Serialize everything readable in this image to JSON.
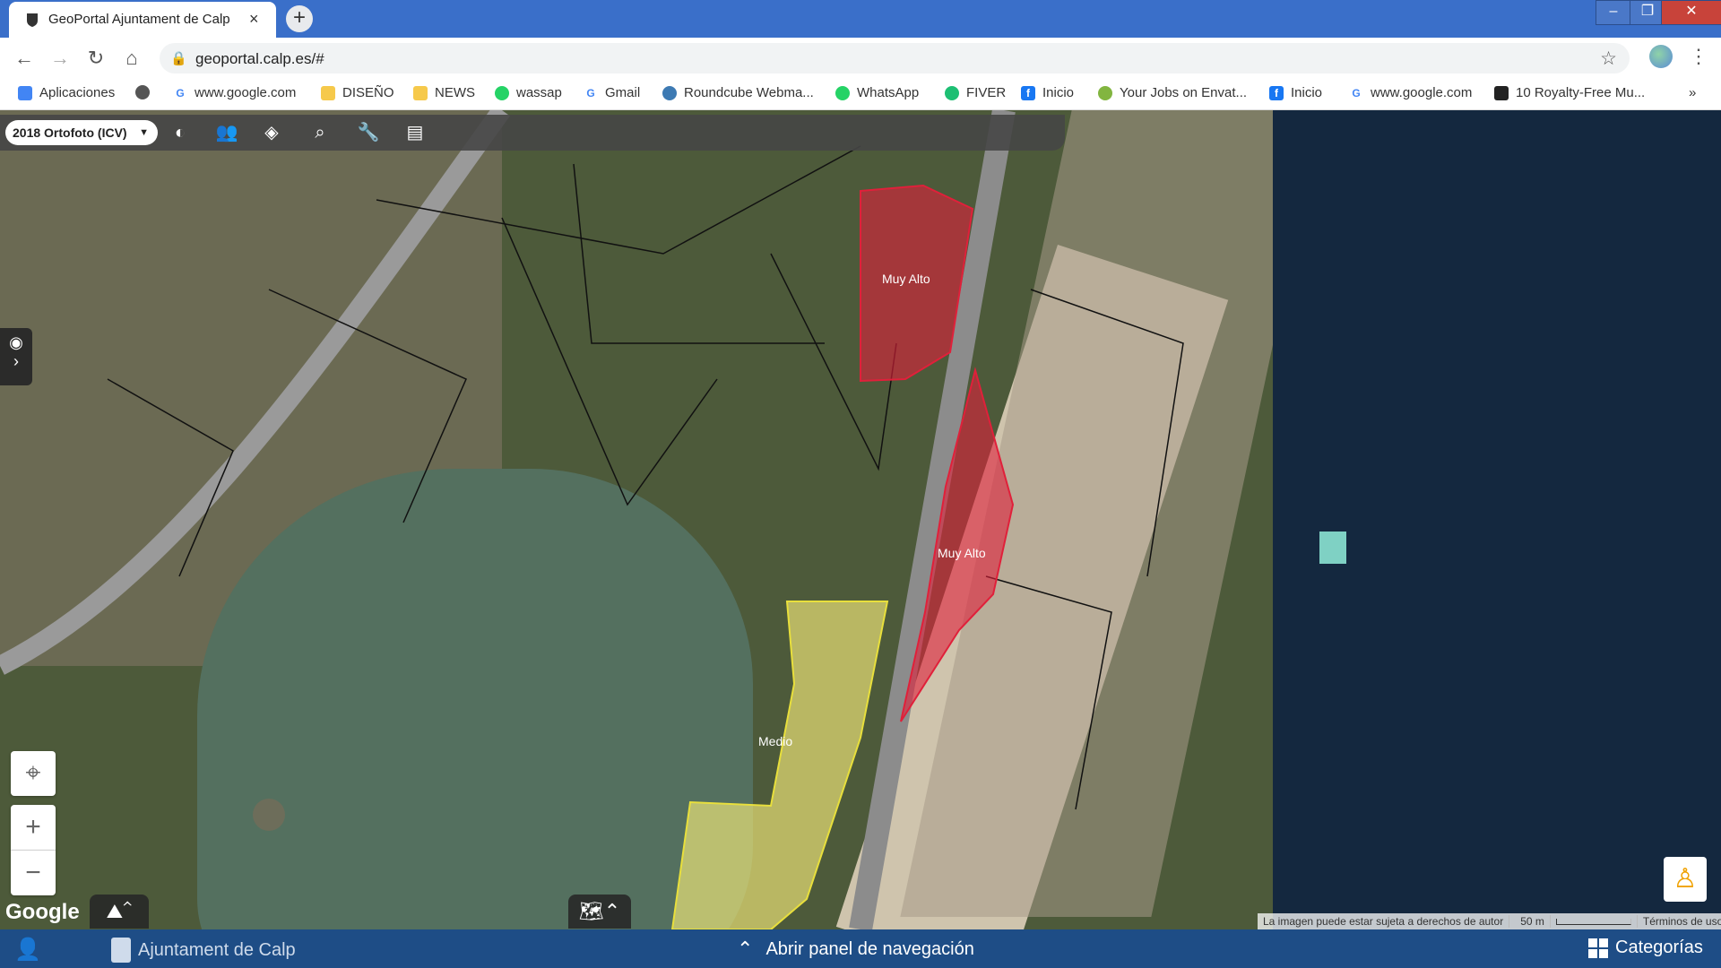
{
  "browser": {
    "tab_title": "GeoPortal Ajuntament de Calp",
    "tab_close": "×",
    "new_tab": "+",
    "url": "geoportal.calp.es/#",
    "window_controls": [
      "–",
      "❐",
      "✕"
    ]
  },
  "bookmarks": [
    {
      "label": "Aplicaciones",
      "icon": "apps-grid-icon",
      "color": "#4285f4"
    },
    {
      "label": "",
      "icon": "globe-icon",
      "color": "#555555"
    },
    {
      "label": "www.google.com",
      "icon": "google-icon",
      "color": "#4285f4"
    },
    {
      "label": "DISEÑO",
      "icon": "folder-icon",
      "color": "#f6c94b"
    },
    {
      "label": "NEWS",
      "icon": "folder-icon",
      "color": "#f6c94b"
    },
    {
      "label": "wassap",
      "icon": "whatsapp-icon",
      "color": "#25d366"
    },
    {
      "label": "Gmail",
      "icon": "google-icon",
      "color": "#4285f4"
    },
    {
      "label": "Roundcube Webma...",
      "icon": "roundcube-icon",
      "color": "#3d7ab3"
    },
    {
      "label": "WhatsApp",
      "icon": "whatsapp-icon",
      "color": "#25d366"
    },
    {
      "label": "FIVER",
      "icon": "fiverr-icon",
      "color": "#1dbf73"
    },
    {
      "label": "Inicio",
      "icon": "facebook-icon",
      "color": "#1877f2"
    },
    {
      "label": "Your Jobs on Envat...",
      "icon": "envato-icon",
      "color": "#82b540"
    },
    {
      "label": "Inicio",
      "icon": "facebook-icon",
      "color": "#1877f2"
    },
    {
      "label": "www.google.com",
      "icon": "google-icon",
      "color": "#4285f4"
    },
    {
      "label": "10 Royalty-Free Mu...",
      "icon": "music-icon",
      "color": "#222222"
    }
  ],
  "bookmarks_more": "»",
  "map": {
    "layer_selector": "2018 Ortofoto (ICV)",
    "zones": [
      {
        "label": "Muy Alto",
        "color": "#e0203a"
      },
      {
        "label": "Muy Alto",
        "color": "#e0203a"
      },
      {
        "label": "Medio",
        "color": "#f2ea7a"
      }
    ],
    "attribution": "La imagen puede estar sujeta a derechos de autor",
    "scale": "50 m",
    "terms": "Términos de uso",
    "google_logo": "Google"
  },
  "footer": {
    "brand": "Ajuntament de Calp",
    "nav_panel": "Abrir panel de navegación",
    "categories": "Categorías"
  }
}
